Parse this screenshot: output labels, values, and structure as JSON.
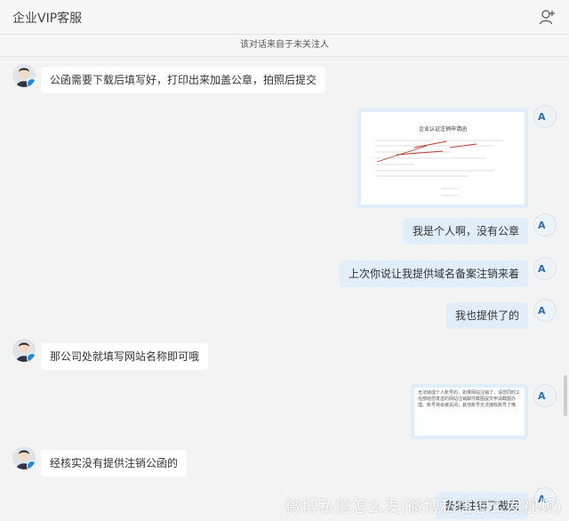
{
  "header": {
    "title": "企业VIP客服"
  },
  "notice": "该对话来自于未关注人",
  "messages": [
    {
      "side": "left",
      "text": "公函需要下载后填写好，打印出来加盖公章，拍照后提交"
    },
    {
      "side": "right",
      "type": "image",
      "doc_title": "企业认证注销申请函"
    },
    {
      "side": "right",
      "text": "我是个人啊，没有公章"
    },
    {
      "side": "right",
      "text": "上次你说让我提供域名备案注销来着"
    },
    {
      "side": "right",
      "text": "我也提供了的"
    },
    {
      "side": "left",
      "text": "那公司处就填写网站名称即可哦"
    },
    {
      "side": "right",
      "type": "image",
      "doc_text": "无法转成个人账号的，如果网站注销了，请您同时工信部给您发送的网站注销邮件截图提交申请截图办理。账号将会被关闭，其他账号无法接收账号了哦"
    },
    {
      "side": "left",
      "text": "经核实没有提供注销公函的"
    },
    {
      "side": "right",
      "text": "备案注销了截图"
    }
  ],
  "watermark": "微博私信怎么发(微博私信怎么发视频)",
  "avatar_label": "A"
}
